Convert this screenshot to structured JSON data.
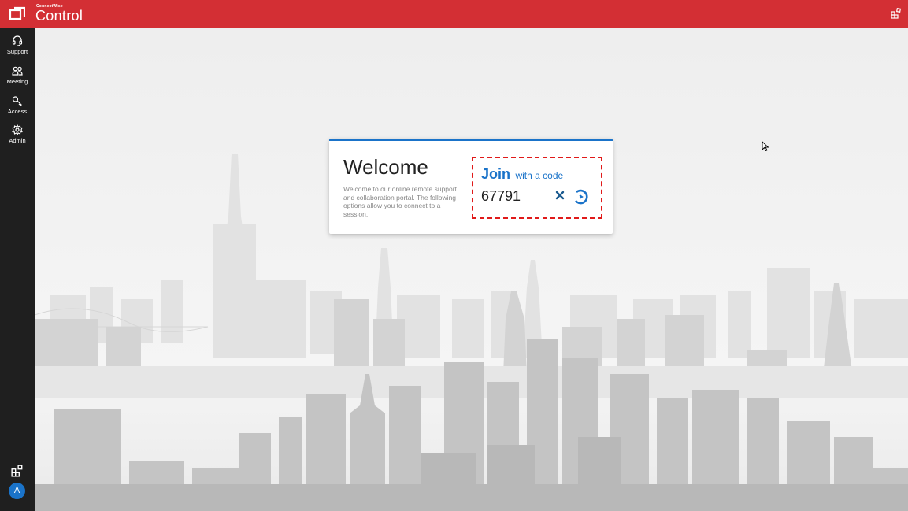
{
  "header": {
    "brand_small": "ConnectWise",
    "brand_big": "Control",
    "logo_icon": "connectwise-logo-icon",
    "right_icon": "extensions-icon"
  },
  "sidebar": {
    "items": [
      {
        "label": "Support",
        "icon": "headset-icon"
      },
      {
        "label": "Meeting",
        "icon": "people-icon"
      },
      {
        "label": "Access",
        "icon": "key-icon"
      },
      {
        "label": "Admin",
        "icon": "gear-icon"
      }
    ],
    "bottom_icon": "extensions-icon",
    "avatar_letter": "A"
  },
  "card": {
    "title": "Welcome",
    "description": "Welcome to our online remote support and collaboration portal. The following options allow you to connect to a session.",
    "join_bold": "Join",
    "join_rest": "with a code",
    "code_value": "67791",
    "accent_color": "#1a73c9",
    "highlight_color": "#e01a1a"
  },
  "colors": {
    "topbar": "#d32f34",
    "sidebar": "#1f1f1f"
  }
}
